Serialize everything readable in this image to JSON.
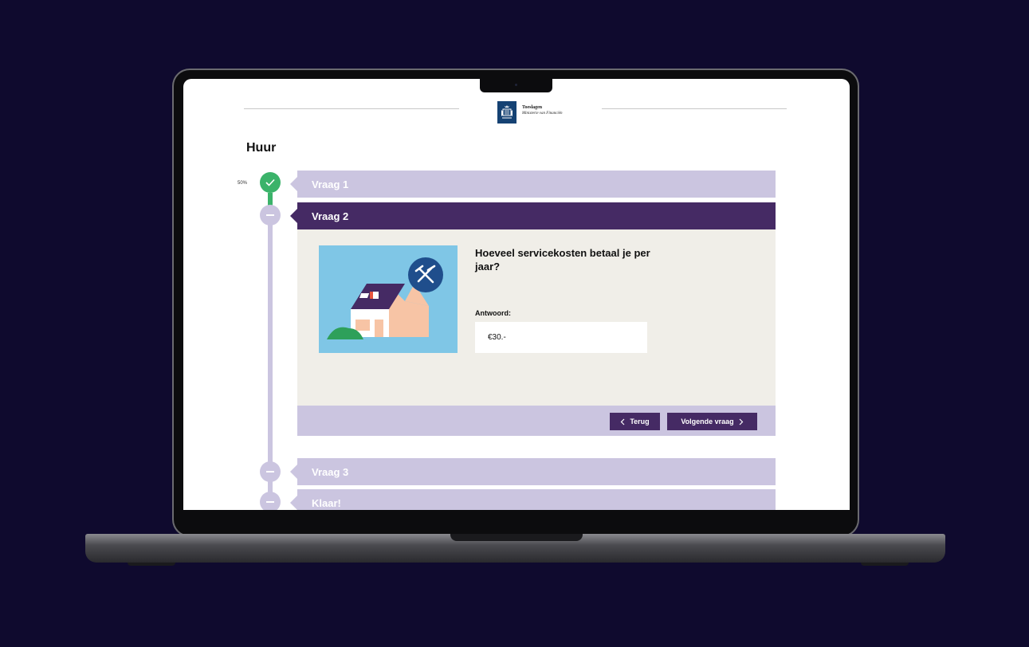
{
  "header": {
    "logo_title": "Toeslagen",
    "logo_subtitle": "Ministerie van Financiën"
  },
  "page": {
    "title": "Huur"
  },
  "progress": {
    "label": "50%",
    "value": 0.5
  },
  "steps": [
    {
      "label": "Vraag 1",
      "state": "done"
    },
    {
      "label": "Vraag 2",
      "state": "active"
    },
    {
      "label": "Vraag 3",
      "state": "pending"
    },
    {
      "label": "Klaar!",
      "state": "pending"
    }
  ],
  "question": {
    "text": "Hoeveel servicekosten betaal je per jaar?",
    "answer_label": "Antwoord:",
    "answer_value": "€30.-"
  },
  "nav": {
    "back_label": "Terug",
    "next_label": "Volgende vraag"
  },
  "colors": {
    "background": "#0f0a2e",
    "accent": "#452a64",
    "step_inactive": "#cbc5e0",
    "done_green": "#3bb36a",
    "panel": "#f0eee8",
    "illustration_sky": "#7fc6e6"
  },
  "icons": [
    "check-icon",
    "minus-icon",
    "chevron-left-icon",
    "chevron-right-icon",
    "tools-icon",
    "royal-emblem-icon"
  ]
}
